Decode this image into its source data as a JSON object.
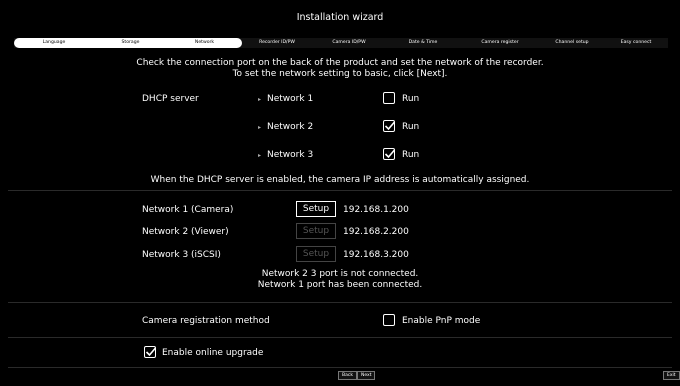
{
  "window": {
    "title": "Installation wizard"
  },
  "steps": [
    {
      "label": "Language"
    },
    {
      "label": "Storage"
    },
    {
      "label": "Network"
    },
    {
      "label": "Recorder ID/PW"
    },
    {
      "label": "Camera ID/PW"
    },
    {
      "label": "Date & Time"
    },
    {
      "label": "Camera register"
    },
    {
      "label": "Channel setup"
    },
    {
      "label": "Easy connect"
    }
  ],
  "intro": {
    "line1": "Check the connection port on the back of the product and set the network of the recorder.",
    "line2": "To set the network setting to basic, click [Next]."
  },
  "dhcp": {
    "label": "DHCP server",
    "networks": [
      {
        "name": "Network 1",
        "run_label": "Run",
        "checked": false
      },
      {
        "name": "Network 2",
        "run_label": "Run",
        "checked": true
      },
      {
        "name": "Network 3",
        "run_label": "Run",
        "checked": true
      }
    ],
    "note": "When the DHCP server is enabled, the camera IP address is automatically assigned."
  },
  "networks": [
    {
      "label": "Network 1 (Camera)",
      "button": "Setup",
      "enabled": true,
      "ip": "192.168.1.200"
    },
    {
      "label": "Network 2 (Viewer)",
      "button": "Setup",
      "enabled": false,
      "ip": "192.168.2.200"
    },
    {
      "label": "Network 3 (iSCSI)",
      "button": "Setup",
      "enabled": false,
      "ip": "192.168.3.200"
    }
  ],
  "port_status": {
    "line1": "Network 2 3  port is not connected.",
    "line2": "Network 1  port has been connected."
  },
  "registration": {
    "label": "Camera registration method",
    "pnp_label": "Enable PnP mode",
    "pnp_checked": false
  },
  "upgrade": {
    "label": "Enable online upgrade",
    "checked": true
  },
  "footer": {
    "back": "Back",
    "next": "Next",
    "exit": "Exit"
  }
}
